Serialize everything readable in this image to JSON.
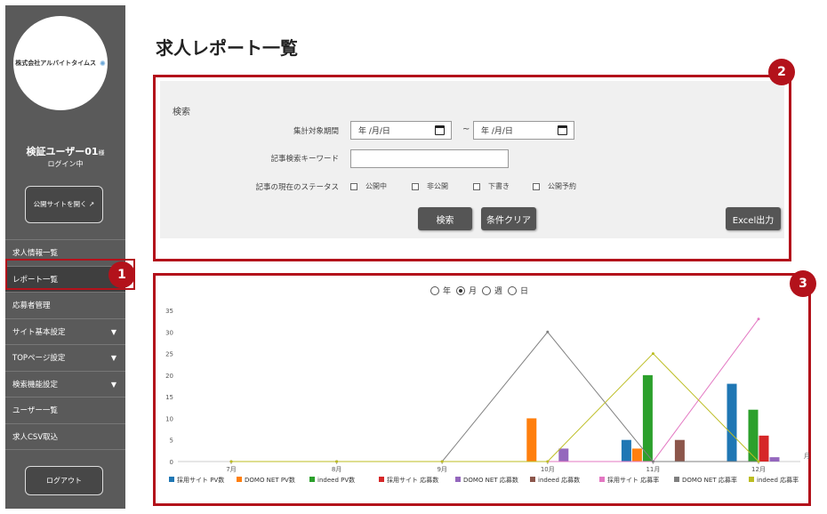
{
  "sidebar": {
    "logo_text": "株式会社アルバイトタイムス",
    "user_name": "検証ユーザー01",
    "user_suffix": "様",
    "login_status": "ログイン中",
    "open_site_label": "公開サイトを開く ↗",
    "nav_items": [
      {
        "label": "求人情報一覧",
        "caret": ""
      },
      {
        "label": "レポート一覧",
        "caret": ""
      },
      {
        "label": "応募者管理",
        "caret": ""
      },
      {
        "label": "サイト基本設定",
        "caret": "▼"
      },
      {
        "label": "TOPページ設定",
        "caret": "▼"
      },
      {
        "label": "検索機能設定",
        "caret": "▼"
      },
      {
        "label": "ユーザー一覧",
        "caret": ""
      },
      {
        "label": "求人CSV取込",
        "caret": ""
      }
    ],
    "logout_label": "ログアウト"
  },
  "badges": {
    "one": "1",
    "two": "2",
    "three": "3"
  },
  "main": {
    "title": "求人レポート一覧",
    "search": {
      "heading": "検索",
      "period_label": "集計対象期間",
      "date_from_placeholder": "年 /月/日",
      "date_to_placeholder": "年 /月/日",
      "tilde": "~",
      "keyword_label": "記事検索キーワード",
      "keyword_value": "",
      "status_label": "記事の現在のステータス",
      "status_options": [
        "公開中",
        "非公開",
        "下書き",
        "公開予約"
      ],
      "search_button": "検索",
      "clear_button": "条件クリア",
      "excel_button": "Excel出力"
    },
    "period_options": [
      {
        "label": "年",
        "selected": false
      },
      {
        "label": "月",
        "selected": true
      },
      {
        "label": "週",
        "selected": false
      },
      {
        "label": "日",
        "selected": false
      }
    ]
  },
  "chart_data": {
    "type": "bar",
    "categories": [
      "7月",
      "8月",
      "9月",
      "10月",
      "11月",
      "12月"
    ],
    "x_axis_suffix": "月",
    "ylim": [
      0,
      35
    ],
    "yticks": [
      0,
      5,
      10,
      15,
      20,
      25,
      30,
      35
    ],
    "bar_series": [
      {
        "name": "採用サイト PV数",
        "color": "#1f77b4",
        "values": [
          0,
          0,
          0,
          0,
          5,
          18
        ]
      },
      {
        "name": "DOMO NET PV数",
        "color": "#ff7f0e",
        "values": [
          0,
          0,
          0,
          10,
          3,
          0
        ]
      },
      {
        "name": "indeed PV数",
        "color": "#2ca02c",
        "values": [
          0,
          0,
          0,
          0,
          20,
          12
        ]
      },
      {
        "name": "採用サイト 応募数",
        "color": "#d62728",
        "values": [
          0,
          0,
          0,
          0,
          0,
          6
        ]
      },
      {
        "name": "DOMO NET 応募数",
        "color": "#9467bd",
        "values": [
          0,
          0,
          0,
          3,
          0,
          1
        ]
      },
      {
        "name": "indeed 応募数",
        "color": "#8c564b",
        "values": [
          0,
          0,
          0,
          0,
          5,
          0
        ]
      }
    ],
    "line_series": [
      {
        "name": "採用サイト 応募率",
        "color": "#e377c2",
        "values": [
          0,
          0,
          0,
          0,
          0,
          33
        ]
      },
      {
        "name": "DOMO NET 応募率",
        "color": "#7f7f7f",
        "values": [
          0,
          0,
          0,
          30,
          0,
          0
        ]
      },
      {
        "name": "indeed 応募率",
        "color": "#bcbd22",
        "values": [
          0,
          0,
          0,
          0,
          25,
          0
        ]
      }
    ]
  }
}
